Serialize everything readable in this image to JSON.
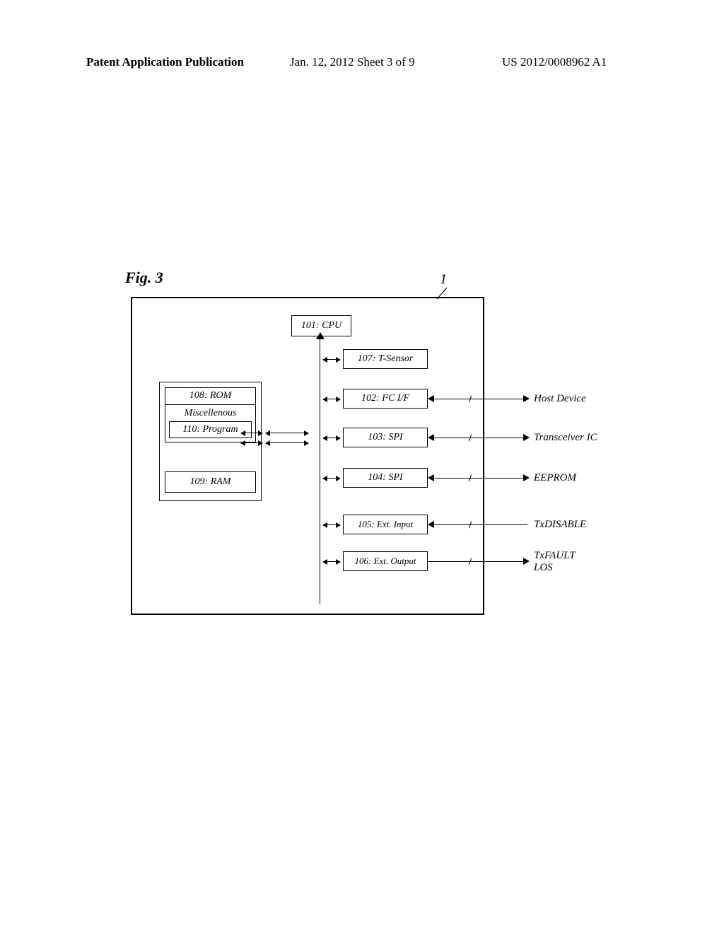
{
  "header": {
    "left": "Patent Application Publication",
    "center": "Jan. 12, 2012  Sheet 3 of 9",
    "right": "US 2012/0008962 A1"
  },
  "figure": {
    "label": "Fig. 3",
    "ref": "1",
    "blocks": {
      "cpu": "101: CPU",
      "tsensor": "107: T-Sensor",
      "i2c": "102: I²C I/F",
      "spi1": "103: SPI",
      "spi2": "104: SPI",
      "extin": "105:  Ext. Input",
      "extout": "106: Ext. Output",
      "rom": "108: ROM",
      "misc": "Miscellenous",
      "program": "110: Program",
      "ram": "109: RAM"
    },
    "connections": {
      "host": "Host Device",
      "trans": "Transceiver IC",
      "eeprom": "EEPROM",
      "txdis": "TxDISABLE",
      "txfault": "TxFAULT",
      "los": "LOS"
    }
  }
}
